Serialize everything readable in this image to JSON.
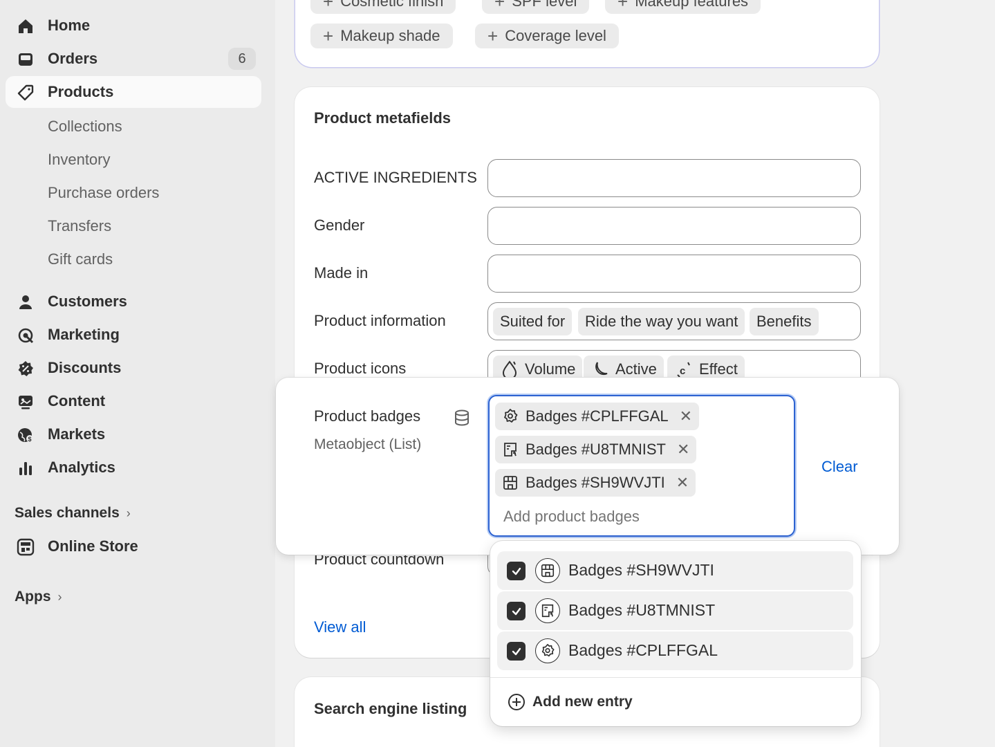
{
  "sidebar": {
    "home": "Home",
    "orders": "Orders",
    "orders_count": "6",
    "products": "Products",
    "sub_items": [
      "Collections",
      "Inventory",
      "Purchase orders",
      "Transfers",
      "Gift cards"
    ],
    "customers": "Customers",
    "marketing": "Marketing",
    "discounts": "Discounts",
    "content": "Content",
    "markets": "Markets",
    "analytics": "Analytics",
    "sales_channels": "Sales channels",
    "online_store": "Online Store",
    "apps": "Apps"
  },
  "top_card": {
    "row1": [
      "Cosmetic finish",
      "SPF level",
      "Makeup features"
    ],
    "row2": [
      "Makeup shade",
      "Coverage level"
    ]
  },
  "metafields": {
    "title": "Product metafields",
    "active_ingredients": "ACTIVE INGREDIENTS",
    "gender": "Gender",
    "made_in": "Made in",
    "product_information": "Product information",
    "product_information_tags": [
      "Suited for",
      "Ride the way you want",
      "Benefits"
    ],
    "product_icons": "Product icons",
    "product_icons_tags": [
      "Volume",
      "Active",
      "Effect"
    ],
    "product_countdown": "Product countdown",
    "view_all": "View all"
  },
  "seo": {
    "title": "Search engine listing"
  },
  "badges_popover": {
    "label": "Product badges",
    "type": "Metaobject (List)",
    "selected": [
      "Badges #CPLFFGAL",
      "Badges #U8TMNIST",
      "Badges #SH9WVJTI"
    ],
    "placeholder": "Add product badges",
    "clear": "Clear"
  },
  "dropdown": {
    "options": [
      "Badges #SH9WVJTI",
      "Badges #U8TMNIST",
      "Badges #CPLFFGAL"
    ],
    "add_new": "Add new entry"
  },
  "colors": {
    "accent": "#005bd3",
    "focus": "#2c62d1"
  }
}
